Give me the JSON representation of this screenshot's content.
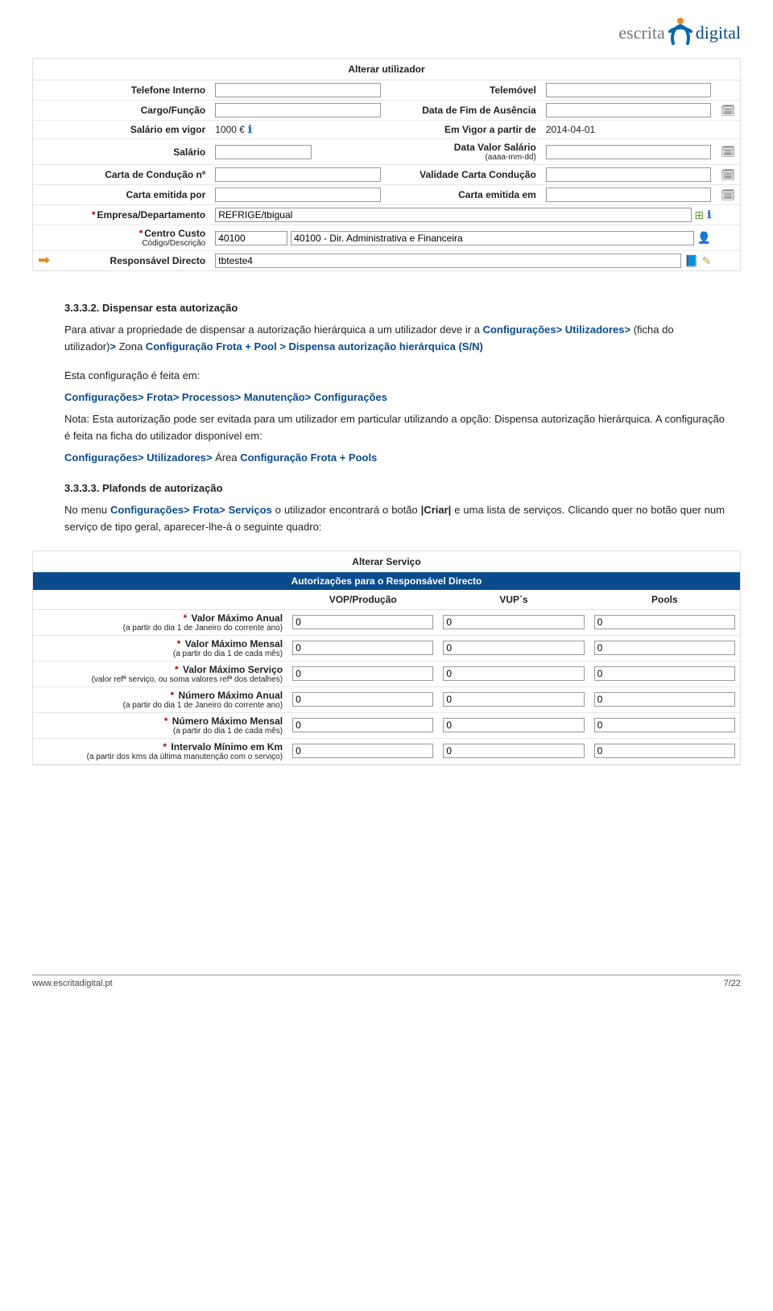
{
  "logo": {
    "part1": "escrita",
    "part2": "digital"
  },
  "form1": {
    "title": "Alterar utilizador",
    "rows": {
      "tel_int_lbl": "Telefone Interno",
      "telemovel_lbl": "Telemóvel",
      "cargo_lbl": "Cargo/Função",
      "fim_ausencia_lbl": "Data de Fim de Ausência",
      "salario_vigor_lbl": "Salário em vigor",
      "salario_vigor_val": "1000 €",
      "em_vigor_lbl": "Em Vigor a partir de",
      "em_vigor_val": "2014-04-01",
      "salario_lbl": "Salário",
      "data_valor_lbl": "Data Valor Salário",
      "data_valor_sub": "(aaaa-mm-dd)",
      "carta_num_lbl": "Carta de Condução nº",
      "validade_carta_lbl": "Validade Carta Condução",
      "carta_emitida_por_lbl": "Carta emitida por",
      "carta_emitida_em_lbl": "Carta emitida em",
      "empresa_lbl": "Empresa/Departamento",
      "empresa_val": "REFRIGE/tbigual",
      "centro_lbl": "Centro Custo",
      "centro_sub": "Código/Descrição",
      "centro_code": "40100",
      "centro_desc": "40100 - Dir. Administrativa e Financeira",
      "responsavel_lbl": "Responsável Directo",
      "responsavel_val": "tbteste4"
    }
  },
  "body": {
    "h1": "3.3.3.2. Dispensar esta autorização",
    "p1a": "Para ativar a propriedade de dispensar a autorização hierárquica a um utilizador deve ir a ",
    "p1b": "Configurações> Utilizadores>",
    "p1c": " (ficha do utilizador)",
    "p1d": "> ",
    "p1e": "Zona ",
    "p1f": "Configuração Frota + Pool > Dispensa autorização hierárquica (S/N)",
    "p2a": "Esta configuração é feita em:",
    "p2b": "Configurações> Frota> Processos> Manutenção> Configurações",
    "p3a": "Nota: Esta autorização pode ser evitada para um utilizador em particular utilizando a opção: Dispensa autorização hierárquica. A configuração é feita na ficha do utilizador disponível em:",
    "p3b": "Configurações> Utilizadores>",
    "p3c": " Área ",
    "p3d": "Configuração Frota + Pools",
    "h2": "3.3.3.3. Plafonds de autorização",
    "p4a": "No menu ",
    "p4b": "Configurações> Frota> Serviços",
    "p4c": " o utilizador encontrará o botão ",
    "p4d": "|Criar|",
    "p4e": " e uma lista de serviços. Clicando quer no botão quer num serviço de tipo geral, aparecer-lhe-á o seguinte quadro:"
  },
  "svc": {
    "title": "Alterar Serviço",
    "subtitle": "Autorizações para o Responsável Directo",
    "cols": [
      "VOP/Produção",
      "VUP´s",
      "Pools"
    ],
    "rows": [
      {
        "main": "Valor Máximo Anual",
        "sub": "(a partir do dia 1 de Janeiro do corrente ano)",
        "v": [
          "0",
          "0",
          "0"
        ]
      },
      {
        "main": "Valor Máximo Mensal",
        "sub": "(a partir do dia 1 de cada mês)",
        "v": [
          "0",
          "0",
          "0"
        ]
      },
      {
        "main": "Valor Máximo Serviço",
        "sub": "(valor refª serviço, ou soma valores refª dos detalhes)",
        "v": [
          "0",
          "0",
          "0"
        ]
      },
      {
        "main": "Número Máximo Anual",
        "sub": "(a partir do dia 1 de Janeiro do corrente ano)",
        "v": [
          "0",
          "0",
          "0"
        ]
      },
      {
        "main": "Número Máximo Mensal",
        "sub": "(a partir do dia 1 de cada mês)",
        "v": [
          "0",
          "0",
          "0"
        ]
      },
      {
        "main": "Intervalo Mínimo em Km",
        "sub": "(a partir dos kms da última manutenção com o serviço)",
        "v": [
          "0",
          "0",
          "0"
        ]
      }
    ]
  },
  "footer": {
    "url": "www.escritadigital.pt",
    "page": "7/22"
  }
}
